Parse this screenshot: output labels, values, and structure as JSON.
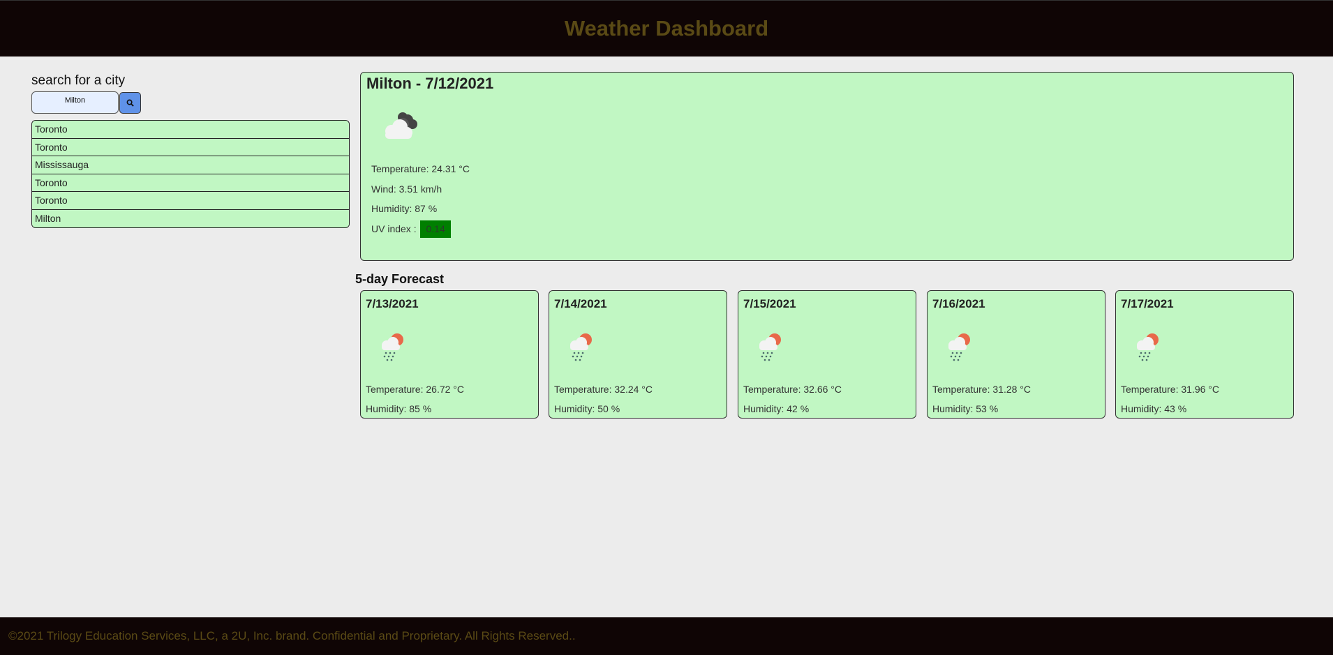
{
  "header": {
    "title": "Weather Dashboard"
  },
  "search": {
    "label": "search for a city",
    "value": "Milton",
    "button_icon": "search-icon"
  },
  "history": [
    {
      "city": "Toronto"
    },
    {
      "city": "Toronto"
    },
    {
      "city": "Mississauga"
    },
    {
      "city": "Toronto"
    },
    {
      "city": "Toronto"
    },
    {
      "city": "Milton"
    }
  ],
  "current": {
    "title": "Milton - 7/12/2021",
    "icon": "broken-clouds-icon",
    "temperature": "Temperature: 24.31 °C",
    "wind": "Wind: 3.51 km/h",
    "humidity": "Humidity: 87 %",
    "uv_label": "UV index :",
    "uv_value": "0.14"
  },
  "forecast": {
    "title": "5-day Forecast",
    "days": [
      {
        "date": "7/13/2021",
        "icon": "sun-rain-icon",
        "temperature": "Temperature: 26.72 °C",
        "humidity": "Humidity: 85 %"
      },
      {
        "date": "7/14/2021",
        "icon": "sun-rain-icon",
        "temperature": "Temperature: 32.24 °C",
        "humidity": "Humidity: 50 %"
      },
      {
        "date": "7/15/2021",
        "icon": "sun-rain-icon",
        "temperature": "Temperature: 32.66 °C",
        "humidity": "Humidity: 42 %"
      },
      {
        "date": "7/16/2021",
        "icon": "sun-rain-icon",
        "temperature": "Temperature: 31.28 °C",
        "humidity": "Humidity: 53 %"
      },
      {
        "date": "7/17/2021",
        "icon": "sun-rain-icon",
        "temperature": "Temperature: 31.96 °C",
        "humidity": "Humidity: 43 %"
      }
    ]
  },
  "footer": {
    "text": "©2021 Trilogy Education Services, LLC, a 2U, Inc. brand. Confidential and Proprietary. All Rights Reserved.."
  },
  "colors": {
    "header_bg": "#0f0505",
    "header_text": "#5a4a15",
    "card_bg": "#c1f7c3",
    "search_button": "#5f92e8",
    "uv_low": "#007f00"
  }
}
